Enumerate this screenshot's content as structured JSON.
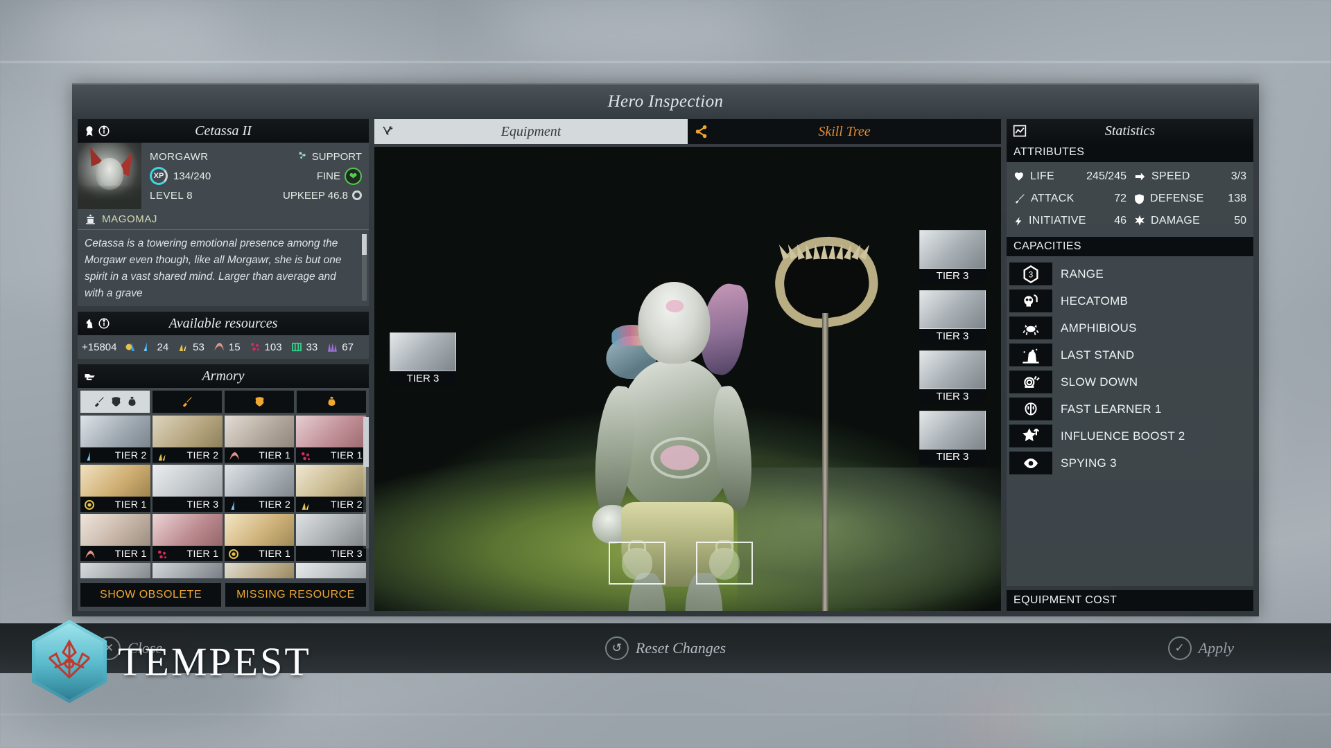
{
  "window": {
    "title": "Hero Inspection"
  },
  "hero": {
    "header_icons": [
      "rank-medal-icon",
      "info-icon"
    ],
    "name": "Cetassa II",
    "faction_race": "MORGAWR",
    "role": "SUPPORT",
    "role_icon": "support-icon",
    "xp_label": "XP",
    "xp_value": "134/240",
    "morale": "FINE",
    "morale_icon": "heart-icon",
    "level": "LEVEL 8",
    "upkeep_label": "UPKEEP 46.8",
    "upkeep_icon": "dust-coin-icon",
    "house_icon": "building-icon",
    "house": "MAGOMAJ",
    "bio": "Cetassa is a towering emotional presence among the Morgawr even though, like all Morgawr, she is but one spirit in a vast shared mind. Larger than average and with a grave"
  },
  "resources": {
    "header_icons": [
      "knight-chess-icon",
      "info-icon"
    ],
    "title": "Available resources",
    "dust": "+15804",
    "dust_icon": "dust-icon",
    "items": [
      {
        "icon": "titanium-icon",
        "color": "#3fa0e0",
        "value": "24"
      },
      {
        "icon": "glassteel-icon",
        "color": "#e3c24d",
        "value": "53"
      },
      {
        "icon": "adamantian-icon",
        "color": "#e49486",
        "value": "15"
      },
      {
        "icon": "palladian-icon",
        "color": "#d8295e",
        "value": "103"
      },
      {
        "icon": "mithrite-icon",
        "color": "#35d18a",
        "value": "33"
      },
      {
        "icon": "orichalcix-icon",
        "color": "#a06fe0",
        "value": "67"
      }
    ]
  },
  "armory": {
    "header_icon": "anvil-icon",
    "title": "Armory",
    "tabs": [
      {
        "name": "all-tab",
        "icons": [
          "sword-icon",
          "armor-icon",
          "pouch-icon"
        ],
        "active": true
      },
      {
        "name": "weapons-tab",
        "icons": [
          "sword-icon"
        ],
        "active": false
      },
      {
        "name": "armor-tab",
        "icons": [
          "armor-icon"
        ],
        "active": false
      },
      {
        "name": "accessory-tab",
        "icons": [
          "pouch-icon"
        ],
        "active": false
      }
    ],
    "items": [
      {
        "name": "ring-titanium",
        "tier": "TIER 2",
        "res_icon": "titanium-icon",
        "res_color": "#3fa0e0",
        "thumb": "linear-gradient(135deg,#dfe4e8 0%,#9fa9b1 50%,#6f7880 100%)"
      },
      {
        "name": "ring-glassteel",
        "tier": "TIER 2",
        "res_icon": "glassteel-icon",
        "res_color": "#e3c24d",
        "thumb": "linear-gradient(135deg,#ded5c0 0%,#b6a67f 50%,#7e7250 100%)"
      },
      {
        "name": "ring-adamantian",
        "tier": "TIER 1",
        "res_icon": "adamantian-icon",
        "res_color": "#e49486",
        "thumb": "linear-gradient(135deg,#e4ded7 0%,#b3a89c 50%,#837a70 100%)"
      },
      {
        "name": "ring-palladian",
        "tier": "TIER 1",
        "res_icon": "palladian-icon",
        "res_color": "#d8295e",
        "thumb": "linear-gradient(135deg,#e6cfd2 0%,#c08e95 50%,#8d5c63 100%)"
      },
      {
        "name": "ring-dust",
        "tier": "TIER 1",
        "res_icon": "dust-coin-icon",
        "res_color": "#e3c24d",
        "thumb": "linear-gradient(135deg,#f0e2c0 0%,#cfae72 50%,#8e7643 100%)"
      },
      {
        "name": "knuckles",
        "tier": "TIER 3",
        "res_icon": "",
        "res_color": "",
        "thumb": "linear-gradient(135deg,#eceef0 0%,#c2c7cb 50%,#959b9f 100%)"
      },
      {
        "name": "pendant-titanium",
        "tier": "TIER 2",
        "res_icon": "titanium-icon",
        "res_color": "#3fa0e0",
        "thumb": "linear-gradient(135deg,#dfe3e6 0%,#a7aeb4 50%,#72797f 100%)"
      },
      {
        "name": "necklace-glassteel",
        "tier": "TIER 2",
        "res_icon": "glassteel-icon",
        "res_color": "#e3c24d",
        "thumb": "linear-gradient(135deg,#efe7d2 0%,#c8b98e 50%,#8a7f5c 100%)"
      },
      {
        "name": "amulet-adamantian",
        "tier": "TIER 1",
        "res_icon": "adamantian-icon",
        "res_color": "#e49486",
        "thumb": "linear-gradient(135deg,#efe6de 0%,#c6b5a6 50%,#8d7f73 100%)"
      },
      {
        "name": "pendant-palladian",
        "tier": "TIER 1",
        "res_icon": "palladian-icon",
        "res_color": "#d8295e",
        "thumb": "linear-gradient(135deg,#ecd5d6 0%,#bc8b90 50%,#86585d 100%)"
      },
      {
        "name": "lute-charm",
        "tier": "TIER 1",
        "res_icon": "dust-coin-icon",
        "res_color": "#e3c24d",
        "thumb": "linear-gradient(135deg,#f3e6c5 0%,#cfb27a 50%,#8f7a4a 100%)"
      },
      {
        "name": "stone-helm",
        "tier": "TIER 3",
        "res_icon": "",
        "res_color": "",
        "thumb": "linear-gradient(135deg,#dfe2e3 0%,#a9aeb1 50%,#6f7478 100%)"
      },
      {
        "name": "gauntlet-a",
        "tier": "",
        "res_icon": "",
        "res_color": "",
        "thumb": "linear-gradient(135deg,#d8dbdd 0%,#9a9fa3 55%,#5f6569 100%)"
      },
      {
        "name": "gauntlet-b",
        "tier": "",
        "res_icon": "",
        "res_color": "",
        "thumb": "linear-gradient(135deg,#d3d7da 0%,#8f959a 55%,#575d61 100%)"
      },
      {
        "name": "whip-item",
        "tier": "",
        "res_icon": "",
        "res_color": "",
        "thumb": "linear-gradient(135deg,#e0dccf 0%,#b09f79 55%,#6d6244 100%)"
      },
      {
        "name": "blade-item",
        "tier": "",
        "res_icon": "",
        "res_color": "",
        "thumb": "linear-gradient(135deg,#e6e9ea 0%,#b3b8bb 55%,#7a8084 100%)"
      }
    ],
    "actions": [
      {
        "name": "show-obsolete-button",
        "label": "SHOW OBSOLETE"
      },
      {
        "name": "missing-resource-button",
        "label": "MISSING RESOURCE"
      }
    ]
  },
  "tabs": {
    "equipment": {
      "label": "Equipment",
      "icon": "wrench-screwdriver-icon",
      "active": true
    },
    "skill_tree": {
      "label": "Skill Tree",
      "icon": "share-nodes-icon",
      "active": false
    }
  },
  "equipment_slots": {
    "left": [
      {
        "name": "weapon-slot",
        "tier": "TIER 3"
      }
    ],
    "right": [
      {
        "name": "helmet-slot",
        "tier": "TIER 3"
      },
      {
        "name": "armor-slot",
        "tier": "TIER 3"
      },
      {
        "name": "offhand-slot",
        "tier": "TIER 3"
      },
      {
        "name": "boots-slot",
        "tier": "TIER 3"
      }
    ],
    "empty": [
      {
        "name": "accessory-slot-1",
        "icon": "pouch-icon"
      },
      {
        "name": "accessory-slot-2",
        "icon": "pouch-icon"
      }
    ]
  },
  "statistics": {
    "header_icon": "chart-line-icon",
    "title": "Statistics",
    "attributes_label": "ATTRIBUTES",
    "attributes": [
      {
        "name": "life",
        "icon": "heart-icon",
        "label": "LIFE",
        "value": "245/245"
      },
      {
        "name": "speed",
        "icon": "arrow-icon",
        "label": "SPEED",
        "value": "3/3"
      },
      {
        "name": "attack",
        "icon": "sword-icon",
        "label": "ATTACK",
        "value": "72"
      },
      {
        "name": "defense",
        "icon": "shield-icon",
        "label": "DEFENSE",
        "value": "138"
      },
      {
        "name": "initiative",
        "icon": "lightning-icon",
        "label": "INITIATIVE",
        "value": "46"
      },
      {
        "name": "damage",
        "icon": "burst-icon",
        "label": "DAMAGE",
        "value": "50"
      }
    ],
    "capacities_label": "CAPACITIES",
    "capacities": [
      {
        "name": "range",
        "icon": "hex-number-icon",
        "badge": "3",
        "label": "RANGE"
      },
      {
        "name": "hecatomb",
        "icon": "skull-icon",
        "badge": "",
        "label": "HECATOMB"
      },
      {
        "name": "amphibious",
        "icon": "crab-icon",
        "badge": "",
        "label": "AMPHIBIOUS"
      },
      {
        "name": "last-stand",
        "icon": "hand-rise-icon",
        "badge": "",
        "label": "LAST STAND"
      },
      {
        "name": "slow-down",
        "icon": "snail-icon",
        "badge": "",
        "label": "SLOW DOWN"
      },
      {
        "name": "fast-learner",
        "icon": "brain-icon",
        "badge": "",
        "label": "FAST LEARNER 1"
      },
      {
        "name": "influence-boost",
        "icon": "star-up-icon",
        "badge": "",
        "label": "INFLUENCE BOOST 2"
      },
      {
        "name": "spying",
        "icon": "eye-icon",
        "badge": "",
        "label": "SPYING 3"
      }
    ],
    "equipment_cost_label": "EQUIPMENT COST"
  },
  "bottom_bar": {
    "close": {
      "label": "Close",
      "icon": "close-circle-icon"
    },
    "reset": {
      "label": "Reset Changes",
      "icon": "undo-icon"
    },
    "apply": {
      "label": "Apply",
      "icon": "check-icon"
    }
  },
  "branding": {
    "logo_text": "TEMPEST",
    "logo_icon": "endless-crown-icon"
  },
  "colors": {
    "accent_orange": "#f0a830",
    "accent_cyan": "#3fd6e0",
    "positive_green": "#4fd14f",
    "panel_dark": "#0b0e10",
    "logo_teal": "#57b9cb",
    "logo_red": "#c0392f"
  }
}
